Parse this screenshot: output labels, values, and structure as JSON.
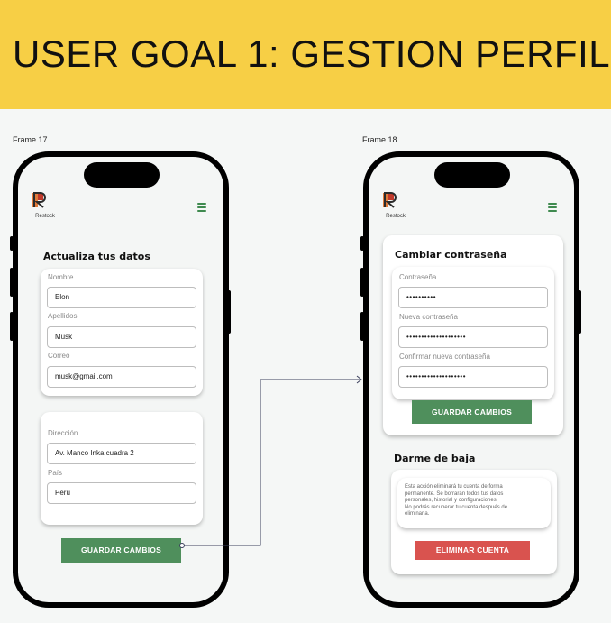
{
  "banner": {
    "title": "USER GOAL 1: GESTION PERFIL"
  },
  "frames": [
    {
      "label": "Frame 17",
      "logo_text": "Restock",
      "section_title": "Actualiza tus datos",
      "fields": [
        {
          "label": "Nombre",
          "value": "Elon"
        },
        {
          "label": "Apellidos",
          "value": "Musk"
        },
        {
          "label": "Correo",
          "value": "musk@gmail.com"
        },
        {
          "label": "Dirección",
          "value": "Av. Manco Inka cuadra 2"
        },
        {
          "label": "País",
          "value": "Perú"
        }
      ],
      "save_button": "GUARDAR CAMBIOS"
    },
    {
      "label": "Frame 18",
      "logo_text": "Restock",
      "password_title": "Cambiar contraseña",
      "fields": [
        {
          "label": "Contraseña",
          "value": "••••••••••"
        },
        {
          "label": "Nueva contraseña",
          "value": "••••••••••••••••••••"
        },
        {
          "label": "Confirmar nueva contraseña",
          "value": "••••••••••••••••••••"
        }
      ],
      "save_button": "GUARDAR CAMBIOS",
      "delete_title": "Darme de baja",
      "delete_description": [
        "Esta acción eliminará tu cuenta de forma",
        "permanente. Se borrarán todos tus datos",
        "personales, historial y configuraciones.",
        "No podrás recuperar tu cuenta después de",
        "eliminarla."
      ],
      "delete_button": "ELIMINAR CUENTA"
    }
  ],
  "colors": {
    "banner": "#f7cf45",
    "green": "#4f8f5c",
    "red": "#d9534f",
    "connector": "#3b3f5c"
  }
}
